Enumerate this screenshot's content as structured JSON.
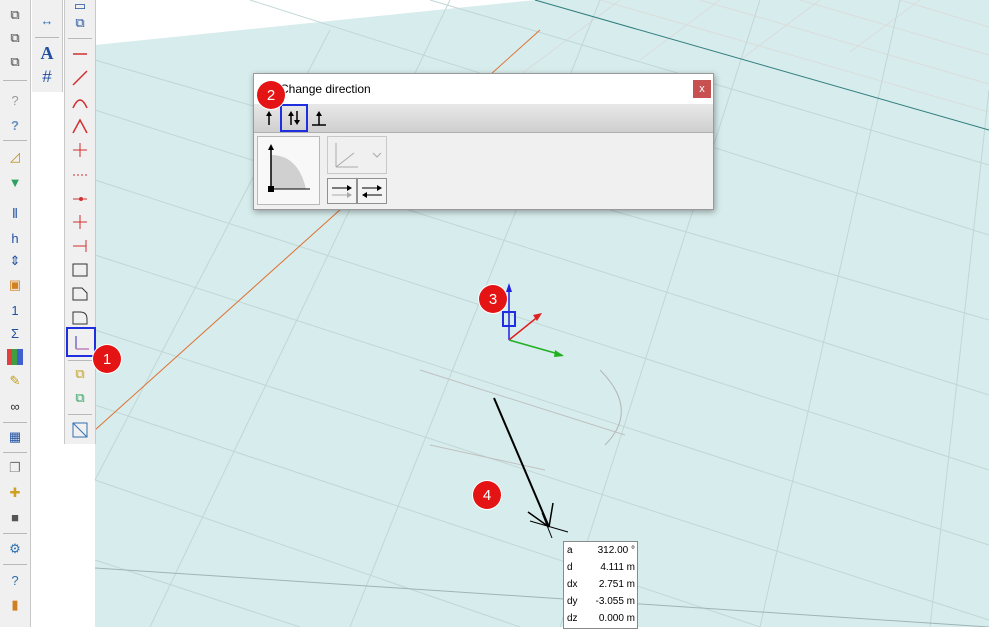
{
  "dialog": {
    "title": "Change direction",
    "close_label": "x",
    "tabs": [
      "single-arrow",
      "double-arrow",
      "perpendicular-arrow"
    ],
    "active_tab": "double-arrow"
  },
  "badges": [
    "1",
    "2",
    "3",
    "4"
  ],
  "coordinates": [
    {
      "label": "a",
      "value": "312.00 °"
    },
    {
      "label": "d",
      "value": "4.111 m"
    },
    {
      "label": "dx",
      "value": "2.751 m"
    },
    {
      "label": "dy",
      "value": "-3.055 m"
    },
    {
      "label": "dz",
      "value": "0.000 m"
    }
  ],
  "colors": {
    "plane": "#d7ecec",
    "grid": "#c8dcdc",
    "highlight": "#1f2fe0",
    "badge": "#e41414",
    "x_axis": "#e02020",
    "y_axis": "#20b020",
    "z_axis": "#2020e0"
  },
  "toolbar_icons": {
    "left": [
      "copy-icon",
      "copy-icon",
      "copy-icon",
      "help-pointer-icon",
      "help-icon",
      "angle-icon",
      "filter-icon",
      "align-icon",
      "height-icon",
      "spacing-icon",
      "frame-icon",
      "numbering-icon",
      "sum-icon",
      "colors-icon",
      "eraser-icon",
      "binoculars-icon",
      "table-icon",
      "layers-icon",
      "add-icon",
      "weight-icon",
      "settings-icon",
      "help-circle-icon",
      "book-icon"
    ],
    "middle": [
      "dimension-icon",
      "text-icon",
      "hash-icon"
    ],
    "right": [
      "window-icon",
      "window-icon",
      "line-icon",
      "line-icon",
      "arc-icon",
      "triangle-icon",
      "cross-icon",
      "dashed-icon",
      "arrow-icon",
      "cross-icon",
      "arrow-icon",
      "rect-icon",
      "rect-icon",
      "rect-icon",
      "change-direction-icon",
      "copy-icon",
      "copy-icon",
      "hatch-icon"
    ]
  }
}
